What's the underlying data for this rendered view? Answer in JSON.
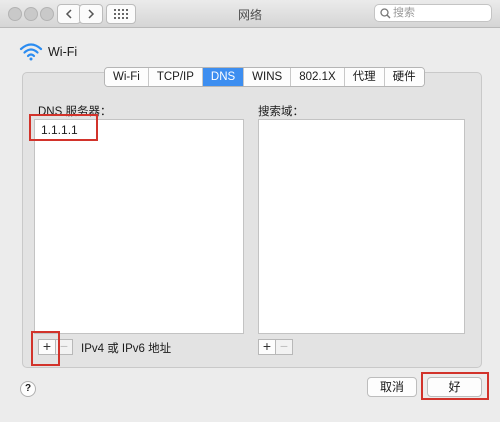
{
  "window": {
    "title": "网络"
  },
  "search": {
    "placeholder": "搜索"
  },
  "service": {
    "name": "Wi-Fi"
  },
  "tabs": [
    {
      "label": "Wi-Fi"
    },
    {
      "label": "TCP/IP"
    },
    {
      "label": "DNS",
      "active": true
    },
    {
      "label": "WINS"
    },
    {
      "label": "802.1X"
    },
    {
      "label": "代理"
    },
    {
      "label": "硬件"
    }
  ],
  "dns": {
    "label": "DNS 服务器：",
    "servers": [
      "1.1.1.1"
    ],
    "add_symbol": "+",
    "remove_symbol": "−",
    "hint": "IPv4 或 IPv6 地址"
  },
  "search_domains": {
    "label": "搜索域：",
    "add_symbol": "+",
    "remove_symbol": "−"
  },
  "footer": {
    "help_symbol": "?",
    "cancel_label": "取消",
    "ok_label": "好"
  },
  "colors": {
    "accent": "#3d8ef0",
    "highlight": "#d2332b"
  }
}
